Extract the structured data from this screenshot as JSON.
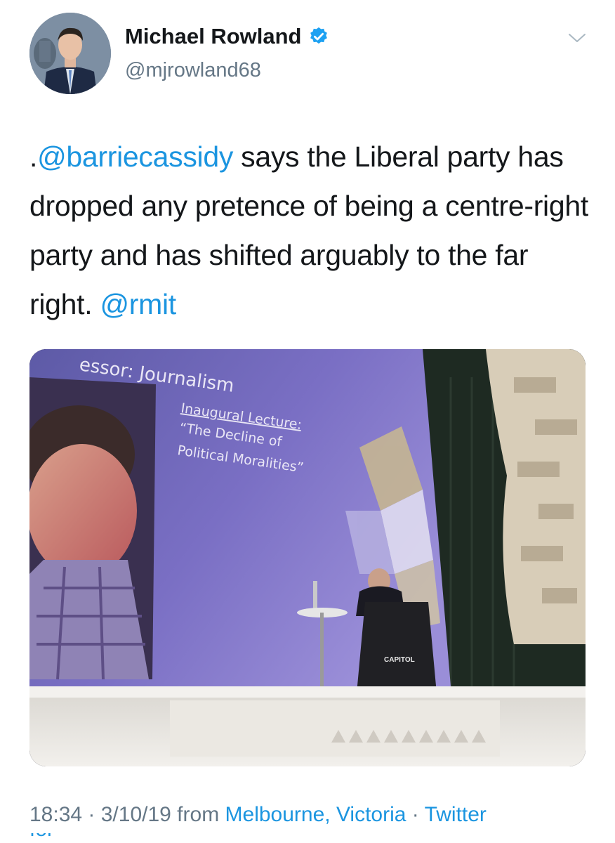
{
  "author": {
    "name": "Michael Rowland",
    "handle": "@mjrowland68",
    "verified": true,
    "avatar_icon": "profile-photo"
  },
  "menu_icon": "chevron-down-icon",
  "tweet": {
    "prefix": ".",
    "mention1": "@barriecassidy",
    "body": " says the Liberal party has dropped any pretence of being a centre-right party and has shifted arguably to the far right. ",
    "mention2": "@rmit"
  },
  "media": {
    "slide_heading": "essor: Journalism",
    "slide_subtitle": "Inaugural Lecture:",
    "slide_line1": "“The Decline of",
    "slide_line2": "Political Moralities”",
    "lectern_label": "CAPITOL",
    "colors": {
      "screen": "#6f66b8",
      "stage": "#e9e6e0",
      "curtain": "#1f2b22"
    }
  },
  "meta": {
    "time": "18:34",
    "sep1": " · ",
    "date": "3/10/19",
    "from": " from ",
    "location": "Melbourne, Victoria",
    "sep2": " · ",
    "client": "Twitter",
    "client_cont": "for iPhone"
  },
  "colors": {
    "link": "#1b95e0",
    "secondary": "#657786",
    "text": "#14171a"
  }
}
